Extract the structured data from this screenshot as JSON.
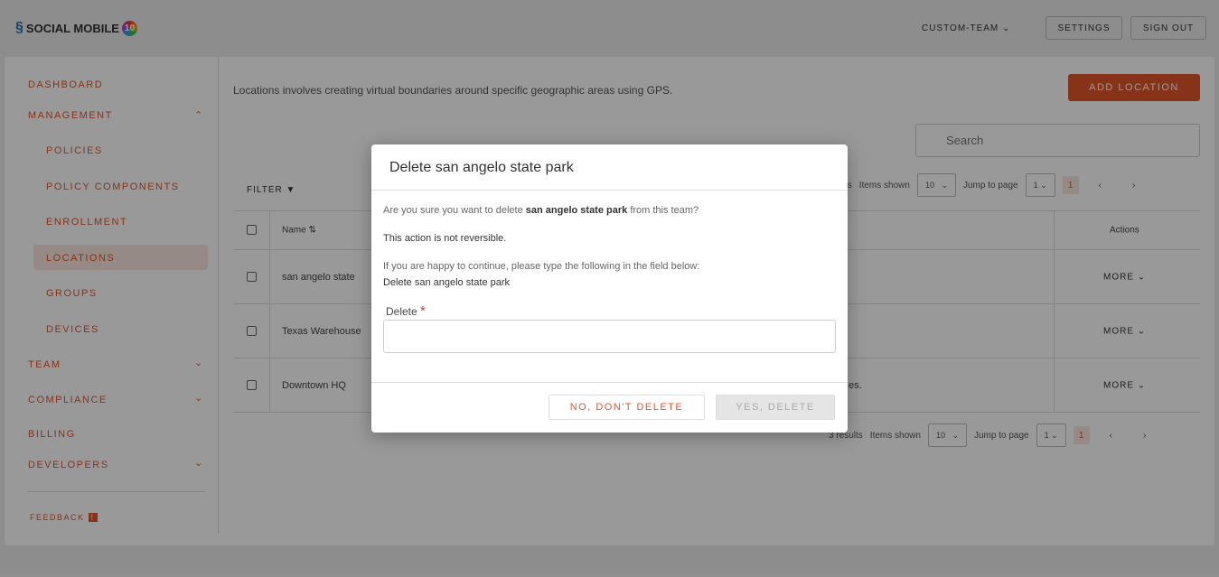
{
  "header": {
    "logo_text": "SOCIAL MOBILE",
    "logo_badge": "10",
    "team": "CUSTOM-TEAM",
    "settings": "SETTINGS",
    "sign_out": "SIGN OUT"
  },
  "sidebar": {
    "items": [
      {
        "label": "DASHBOARD"
      },
      {
        "label": "MANAGEMENT"
      },
      {
        "label": "POLICIES"
      },
      {
        "label": "POLICY COMPONENTS"
      },
      {
        "label": "ENROLLMENT"
      },
      {
        "label": "LOCATIONS"
      },
      {
        "label": "GROUPS"
      },
      {
        "label": "DEVICES"
      },
      {
        "label": "TEAM"
      },
      {
        "label": "COMPLIANCE"
      },
      {
        "label": "BILLING"
      },
      {
        "label": "DEVELOPERS"
      }
    ],
    "feedback": "FEEDBACK"
  },
  "main": {
    "description": "Locations involves creating virtual boundaries around specific geographic areas using GPS.",
    "add_button": "ADD LOCATION",
    "search_placeholder": "Search",
    "filter": "FILTER",
    "pager": {
      "results": "3 results",
      "items_label": "Items shown",
      "items_value": "10",
      "jump_label": "Jump to page",
      "jump_value": "1",
      "current_page": "1"
    },
    "table": {
      "headers": {
        "name": "Name",
        "actions": "Actions"
      },
      "rows": [
        {
          "name": "san angelo state",
          "desc": "",
          "action": "MORE"
        },
        {
          "name": "Texas Warehouse",
          "desc": "",
          "action": "MORE"
        },
        {
          "name": "Downtown HQ",
          "desc": "es.",
          "action": "MORE"
        }
      ]
    }
  },
  "modal": {
    "title": "Delete san angelo state park",
    "confirm_pre": "Are you sure you want to delete ",
    "confirm_name": "san angelo state park",
    "confirm_post": " from this team?",
    "warning": "This action is not reversible.",
    "instruction": "If you are happy to continue, please type the following in the field below:",
    "phrase": "Delete san angelo state park",
    "field_label": "Delete",
    "required_mark": "*",
    "field_value": "",
    "cancel": "NO, DON'T DELETE",
    "confirm": "YES, DELETE"
  },
  "colors": {
    "accent": "#e0552b",
    "overlay": "rgba(0,0,0,0.4)"
  }
}
